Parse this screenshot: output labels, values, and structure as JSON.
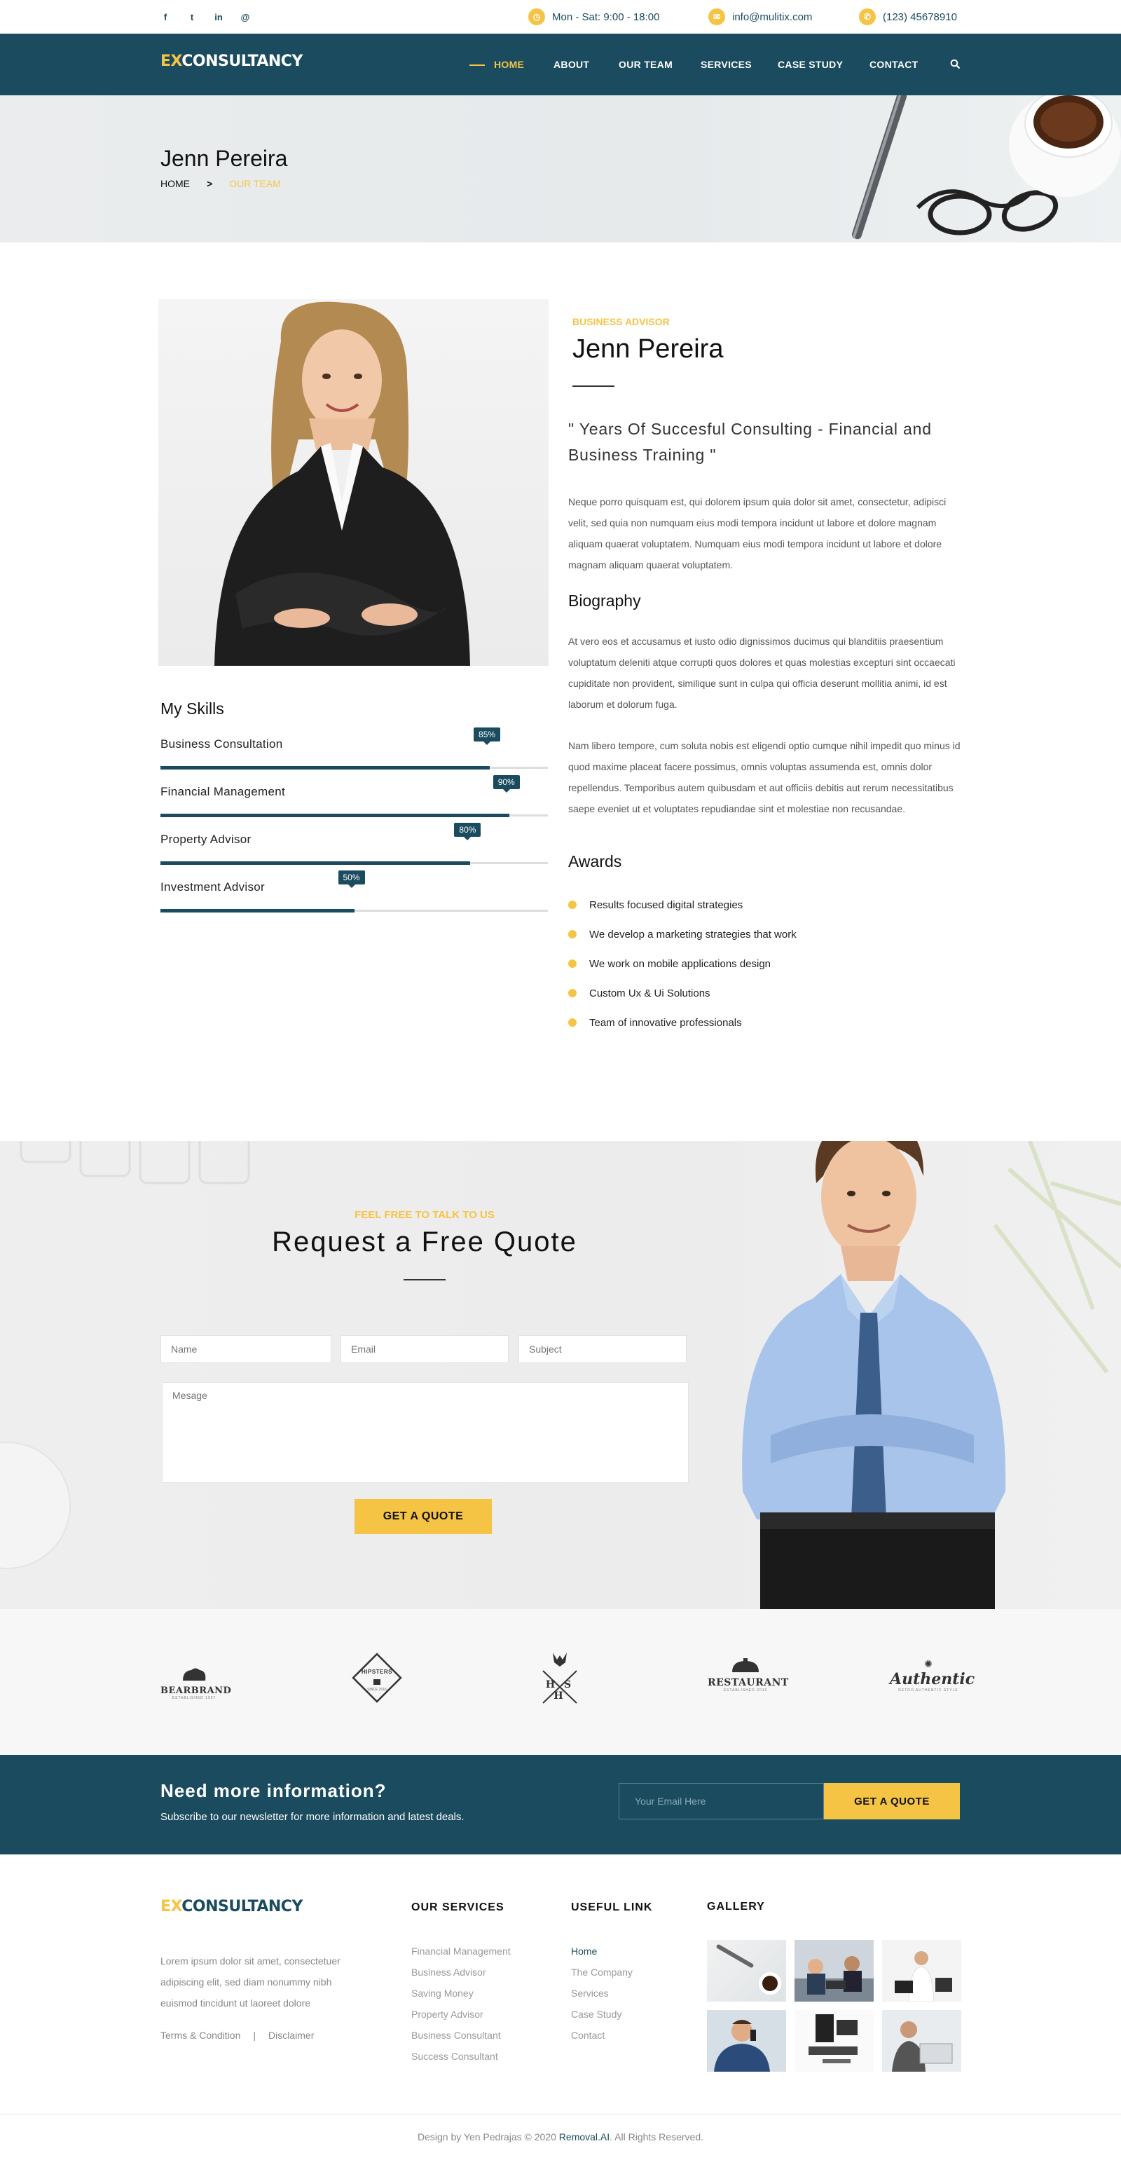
{
  "topbar": {
    "social": [
      "f",
      "t",
      "in",
      "@"
    ],
    "hours": "Mon - Sat: 9:00 - 18:00",
    "email": "info@mulitix.com",
    "phone": "(123) 45678910"
  },
  "nav": {
    "logo_ex": "EX",
    "logo_rest": "CONSULTANCY",
    "items": [
      "HOME",
      "ABOUT",
      "OUR TEAM",
      "SERVICES",
      "CASE STUDY",
      "CONTACT"
    ],
    "active": "HOME",
    "search_icon": "search-icon"
  },
  "hero": {
    "title": "Jenn Pereira",
    "breadcrumb_home": "HOME",
    "breadcrumb_sep": ">",
    "breadcrumb_current": "OUR TEAM"
  },
  "profile": {
    "role": "BUSINESS ADVISOR",
    "name": "Jenn Pereira",
    "quote": "\" Years Of Succesful Consulting - Financial and Business Training \"",
    "intro": "Neque porro quisquam est, qui dolorem ipsum quia dolor sit amet, consectetur, adipisci velit, sed quia non numquam eius modi tempora incidunt ut labore et dolore magnam aliquam quaerat voluptatem. Numquam eius modi tempora incidunt ut labore et dolore magnam aliquam quaerat voluptatem.",
    "bio_title": "Biography",
    "bio_1": "At vero eos et accusamus et iusto odio dignissimos ducimus qui blanditiis praesentium voluptatum deleniti atque corrupti quos dolores et quas molestias excepturi sint occaecati cupiditate non provident, similique sunt in culpa qui officia deserunt mollitia animi, id est laborum et dolorum fuga.",
    "bio_2": "Nam libero tempore, cum soluta nobis est eligendi optio cumque nihil impedit quo minus id quod maxime placeat facere possimus, omnis voluptas assumenda est, omnis dolor repellendus. Temporibus autem quibusdam et aut officiis debitis aut rerum necessitatibus saepe eveniet ut et voluptates repudiandae sint et molestiae non recusandae.",
    "awards_title": "Awards",
    "awards": [
      "Results focused digital strategies",
      "We develop a marketing strategies that work",
      "We work on mobile applications design",
      "Custom Ux & Ui Solutions",
      "Team of innovative professionals"
    ]
  },
  "skills": {
    "title": "My Skills",
    "items": [
      {
        "label": "Business Consultation",
        "value": 0.85,
        "text": "85%"
      },
      {
        "label": "Financial Management",
        "value": 0.9,
        "text": "90%"
      },
      {
        "label": "Property Advisor",
        "value": 0.8,
        "text": "80%"
      },
      {
        "label": "Investment Advisor",
        "value": 0.5,
        "text": "50%"
      }
    ]
  },
  "quote_form": {
    "subtitle": "FEEL FREE TO TALK TO US",
    "title": "Request a Free Quote",
    "name_ph": "Name",
    "email_ph": "Email",
    "subject_ph": "Subject",
    "message_ph": "Mesage",
    "button": "GET A QUOTE"
  },
  "clients": [
    {
      "name": "BEARBRAND",
      "sub": "ESTABLISHED 1997"
    },
    {
      "name": "HIPSTERS",
      "sub": "SINCE 2016"
    },
    {
      "name": "H S H",
      "sub": ""
    },
    {
      "name": "RESTAURANT",
      "sub": "ESTABLISHED 2016"
    },
    {
      "name": "Authentic",
      "sub": "RETRO AUTHENTIC STYLE"
    }
  ],
  "newsletter": {
    "title": "Need more information?",
    "text": "Subscribe to our newsletter for more information and latest deals.",
    "email_ph": "Your Email Here",
    "button": "GET A QUOTE"
  },
  "footer": {
    "logo_ex": "EX",
    "logo_rest": "CONSULTANCY",
    "about": "Lorem ipsum dolor sit amet, consectetuer adipiscing elit, sed diam nonummy nibh euismod tincidunt ut laoreet dolore",
    "terms": "Terms & Condition",
    "sep": "|",
    "disclaimer": "Disclaimer",
    "services_title": "OUR SERVICES",
    "services": [
      "Financial Management",
      "Business Advisor",
      "Saving Money",
      "Property Advisor",
      "Business Consultant",
      "Success Consultant"
    ],
    "links_title": "USEFUL LINK",
    "links": [
      "Home",
      "The Company",
      "Services",
      "Case Study",
      "Contact"
    ],
    "gallery_title": "GALLERY",
    "credit_pre": "Design by Yen Pedrajas © 2020",
    "credit_brand": "Removal.AI",
    "credit_post": ". All Rights Reserved."
  }
}
